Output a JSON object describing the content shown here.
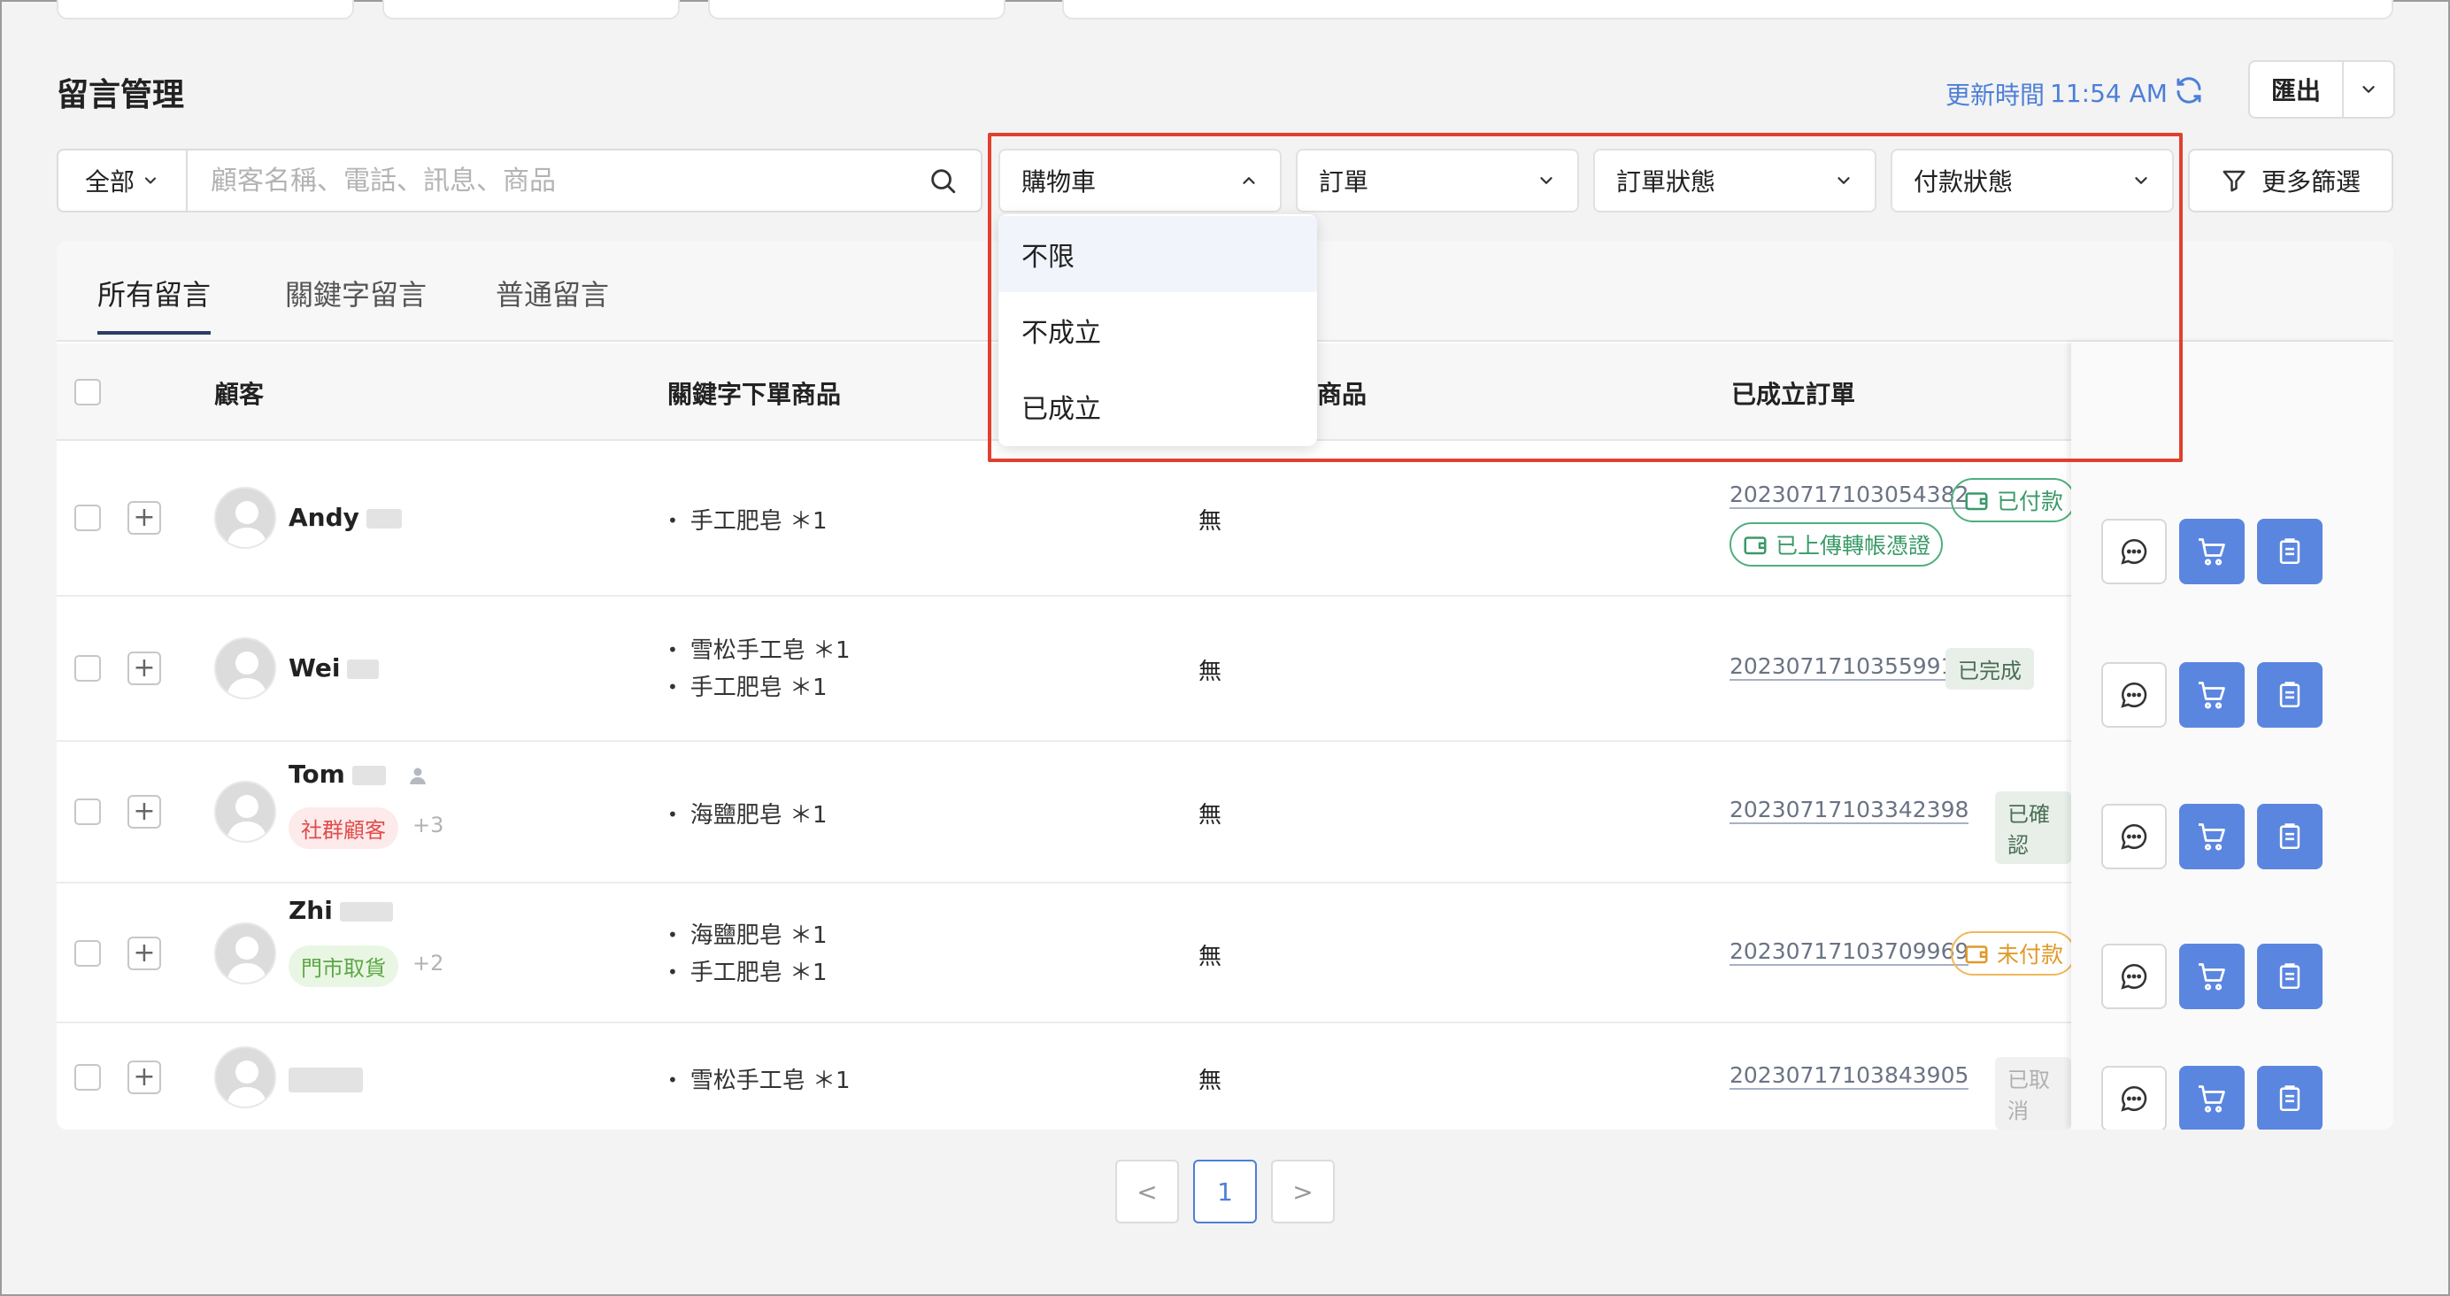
{
  "page_title": "留言管理",
  "updated": {
    "label": "更新時間",
    "time": "11:54 AM"
  },
  "export_label": "匯出",
  "search": {
    "scope": "全部",
    "placeholder": "顧客名稱、電話、訊息、商品"
  },
  "filters": [
    {
      "label": "購物車",
      "open": true
    },
    {
      "label": "訂單"
    },
    {
      "label": "訂單狀態"
    },
    {
      "label": "付款狀態"
    }
  ],
  "more_filters_label": "更多篩選",
  "dropdown_options": [
    "不限",
    "不成立",
    "已成立"
  ],
  "dropdown_selected": "不限",
  "tabs": [
    "所有留言",
    "關鍵字留言",
    "普通留言"
  ],
  "active_tab": "所有留言",
  "columns": {
    "customer": "顧客",
    "keyword_products": "關鍵字下單商品",
    "other_products_partial": "商品",
    "orders": "已成立訂單"
  },
  "rows": [
    {
      "name": "Andy",
      "items": [
        "手工肥皂 ＊1"
      ],
      "other": "無",
      "order": "20230717103054382",
      "status": "已付款",
      "status2": "已上傳轉帳憑證"
    },
    {
      "name": "Wei",
      "items": [
        "雪松手工皂 ＊1",
        "手工肥皂 ＊1"
      ],
      "other": "無",
      "order": "20230717103559915",
      "status": "已完成"
    },
    {
      "name": "Tom",
      "tag": "社群顧客",
      "tag_more": "+3",
      "items": [
        "海鹽肥皂 ＊1"
      ],
      "other": "無",
      "order": "20230717103342398",
      "status": "已確認"
    },
    {
      "name": "Zhi",
      "tag": "門市取貨",
      "tag_more": "+2",
      "items": [
        "海鹽肥皂 ＊1",
        "手工肥皂 ＊1"
      ],
      "other": "無",
      "order": "20230717103709969",
      "status": "未付款"
    },
    {
      "name": "",
      "items": [
        "雪松手工皂 ＊1"
      ],
      "other": "無",
      "order": "20230717103843905",
      "status": "已取消"
    }
  ],
  "pagination": {
    "prev": "<",
    "current": "1",
    "next": ">"
  },
  "colors": {
    "accent": "#5b86e0",
    "highlight": "#e0402e",
    "paid": "#3a9a68",
    "unpaid": "#e09a2a",
    "social_tag": "#e24b4b",
    "pickup_tag": "#5aa845"
  }
}
